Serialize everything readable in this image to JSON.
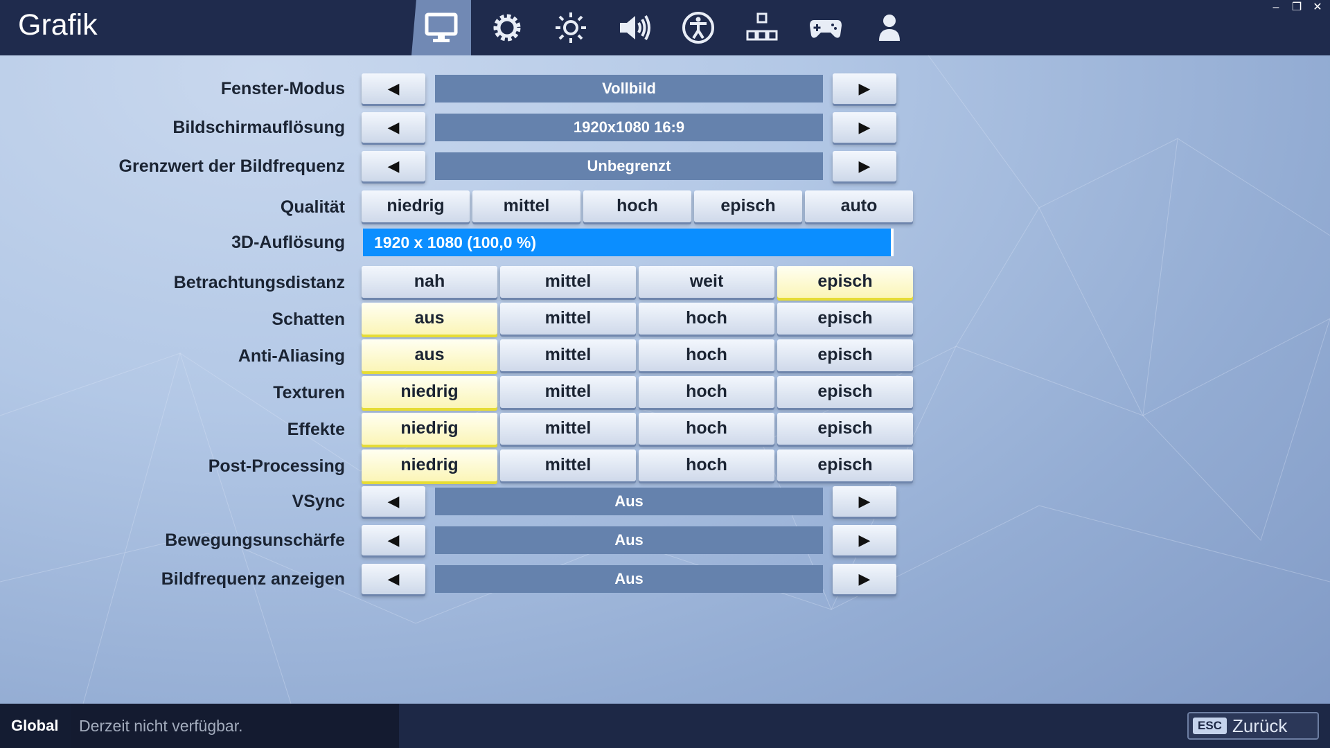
{
  "header": {
    "title": "Grafik",
    "tabs": [
      {
        "icon": "monitor-icon",
        "active": true
      },
      {
        "icon": "gear-icon",
        "active": false
      },
      {
        "icon": "brightness-icon",
        "active": false
      },
      {
        "icon": "speaker-icon",
        "active": false
      },
      {
        "icon": "accessibility-icon",
        "active": false
      },
      {
        "icon": "input-keys-icon",
        "active": false
      },
      {
        "icon": "gamepad-icon",
        "active": false
      },
      {
        "icon": "account-icon",
        "active": false
      }
    ],
    "window_controls": {
      "minimize": "–",
      "restore": "❐",
      "close": "✕"
    }
  },
  "settings": {
    "window_mode": {
      "label": "Fenster-Modus",
      "value": "Vollbild"
    },
    "resolution": {
      "label": "Bildschirmauflösung",
      "value": "1920x1080 16:9"
    },
    "frame_limit": {
      "label": "Grenzwert der Bildfrequenz",
      "value": "Unbegrenzt"
    },
    "quality": {
      "label": "Qualität",
      "options": [
        "niedrig",
        "mittel",
        "hoch",
        "episch",
        "auto"
      ],
      "selected": null
    },
    "resolution_3d": {
      "label": "3D-Auflösung",
      "value": "1920 x 1080 (100,0 %)",
      "level": 1.0
    },
    "view_distance": {
      "label": "Betrachtungsdistanz",
      "options": [
        "nah",
        "mittel",
        "weit",
        "episch"
      ],
      "selected": 3
    },
    "shadows": {
      "label": "Schatten",
      "options": [
        "aus",
        "mittel",
        "hoch",
        "episch"
      ],
      "selected": 0
    },
    "anti_aliasing": {
      "label": "Anti-Aliasing",
      "options": [
        "aus",
        "mittel",
        "hoch",
        "episch"
      ],
      "selected": 0
    },
    "textures": {
      "label": "Texturen",
      "options": [
        "niedrig",
        "mittel",
        "hoch",
        "episch"
      ],
      "selected": 0
    },
    "effects": {
      "label": "Effekte",
      "options": [
        "niedrig",
        "mittel",
        "hoch",
        "episch"
      ],
      "selected": 0
    },
    "post_processing": {
      "label": "Post-Processing",
      "options": [
        "niedrig",
        "mittel",
        "hoch",
        "episch"
      ],
      "selected": 0
    },
    "vsync": {
      "label": "VSync",
      "value": "Aus"
    },
    "motion_blur": {
      "label": "Bewegungsunschärfe",
      "value": "Aus"
    },
    "show_fps": {
      "label": "Bildfrequenz anzeigen",
      "value": "Aus"
    },
    "arrow_left": "◀",
    "arrow_right": "▶"
  },
  "footer": {
    "chat_channel": "Global",
    "chat_status": "Derzeit nicht verfügbar.",
    "back_key": "ESC",
    "back_label": "Zurück"
  },
  "colors": {
    "topbar": "#1f2b4d",
    "active_tab": "#7189b4",
    "value_box": "#6582ad",
    "slider": "#0b8eff",
    "selected_option": "#fbf5b7"
  }
}
